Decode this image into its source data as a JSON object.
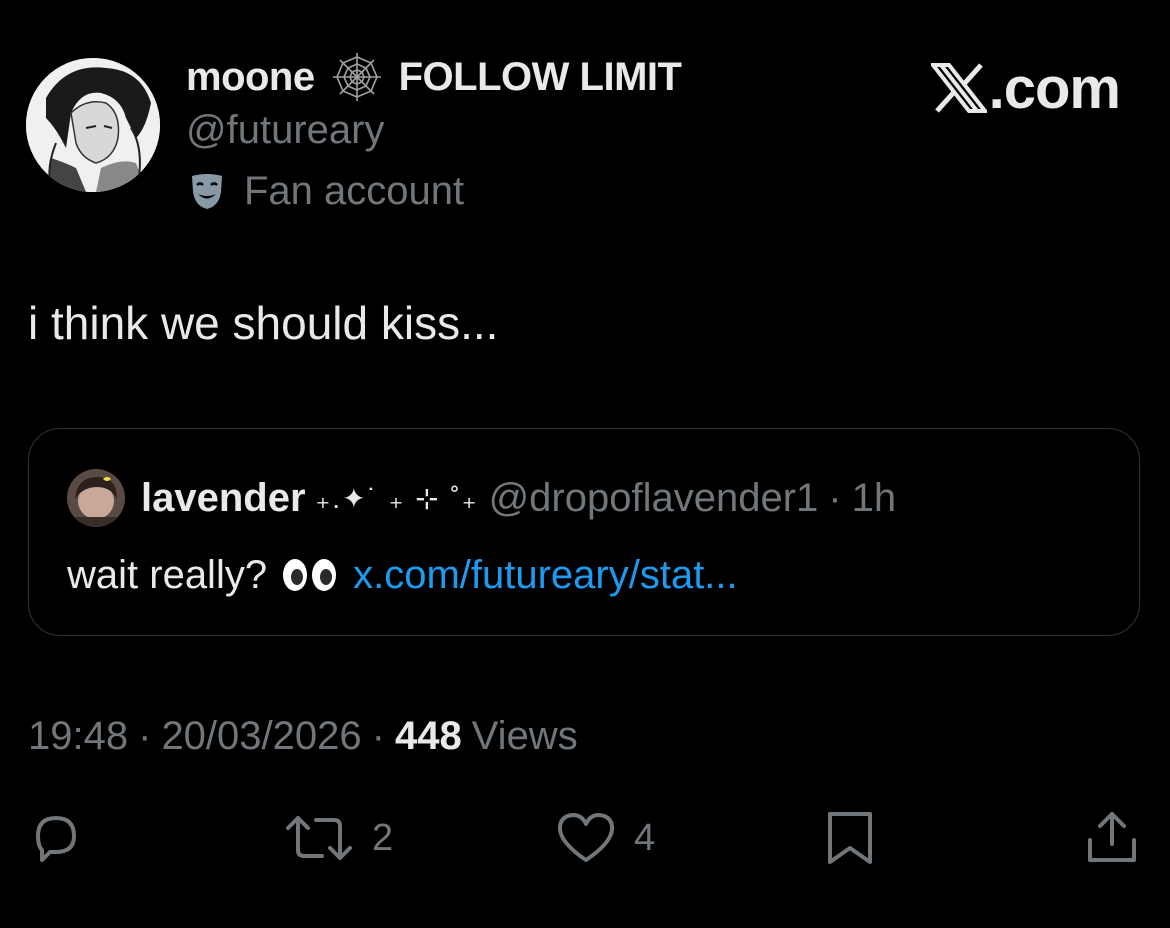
{
  "header": {
    "display_name": "moone",
    "display_name_suffix": "FOLLOW LIMIT",
    "handle": "@futureary",
    "account_label": "Fan account",
    "brand": ".com"
  },
  "tweet": {
    "text": "i think we should kiss..."
  },
  "quote": {
    "name": "lavender",
    "name_decoration": "₊.✦˙ ₊ ⊹ ˚₊",
    "handle": "@dropoflavender1",
    "separator": "·",
    "time": "1h",
    "text": "wait really?",
    "link": "x.com/futureary/stat..."
  },
  "meta": {
    "time": "19:48",
    "sep1": "·",
    "date": "20/03/2026",
    "sep2": "·",
    "views_count": "448",
    "views_label": "Views"
  },
  "actions": {
    "reposts": "2",
    "likes": "4"
  },
  "icons": {
    "reply": "reply-icon",
    "repost": "repost-icon",
    "like": "heart-icon",
    "bookmark": "bookmark-icon",
    "share": "share-icon"
  },
  "colors": {
    "background": "#000000",
    "text": "#e7e9ea",
    "muted": "#71767b",
    "link": "#1d9bf0",
    "border": "#2f3336"
  }
}
